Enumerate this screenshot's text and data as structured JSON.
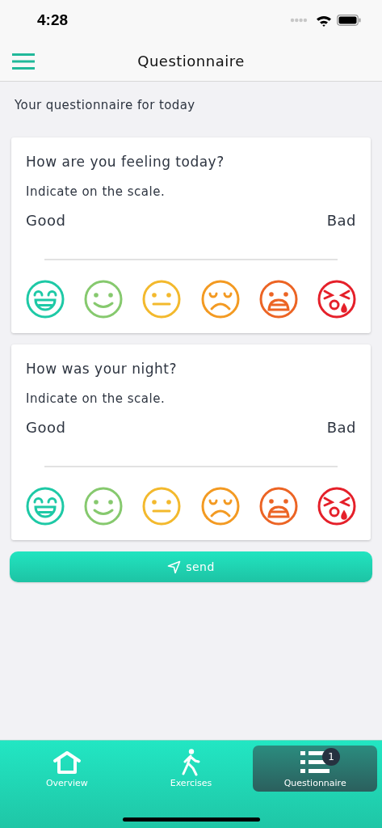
{
  "status_bar": {
    "time": "4:28"
  },
  "header": {
    "title": "Questionnaire"
  },
  "intro": "Your questionnaire for today",
  "questions": [
    {
      "title": "How are you feeling today?",
      "hint": "Indicate on the scale.",
      "low_label": "Good",
      "high_label": "Bad",
      "faces": [
        {
          "kind": "laughing",
          "color": "#1ec9a6"
        },
        {
          "kind": "smiling",
          "color": "#86c96e"
        },
        {
          "kind": "neutral",
          "color": "#f3b92d"
        },
        {
          "kind": "sad",
          "color": "#f39a22"
        },
        {
          "kind": "upset",
          "color": "#ec6424"
        },
        {
          "kind": "crying",
          "color": "#e5202a"
        }
      ]
    },
    {
      "title": "How was your night?",
      "hint": "Indicate on the scale.",
      "low_label": "Good",
      "high_label": "Bad",
      "faces": [
        {
          "kind": "laughing",
          "color": "#1ec9a6"
        },
        {
          "kind": "smiling",
          "color": "#86c96e"
        },
        {
          "kind": "neutral",
          "color": "#f3b92d"
        },
        {
          "kind": "sad",
          "color": "#f39a22"
        },
        {
          "kind": "upset",
          "color": "#ec6424"
        },
        {
          "kind": "crying",
          "color": "#e5202a"
        }
      ]
    }
  ],
  "send_button": "send",
  "tabs": [
    {
      "label": "Overview",
      "kind": "home",
      "selected": false
    },
    {
      "label": "Exercises",
      "kind": "activity",
      "selected": false
    },
    {
      "label": "Questionnaire",
      "kind": "survey",
      "selected": true,
      "badge": "1"
    }
  ]
}
